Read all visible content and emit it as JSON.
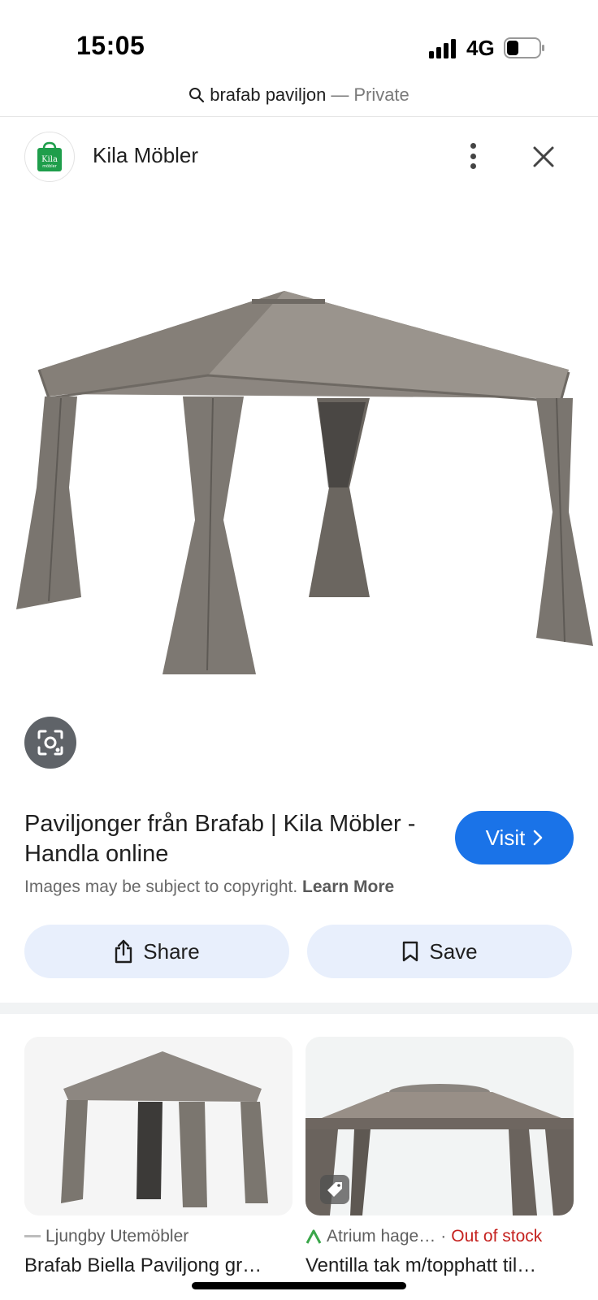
{
  "status_bar": {
    "time": "15:05",
    "network": "4G"
  },
  "search": {
    "query": "brafab paviljon",
    "separator": "—",
    "mode": "Private"
  },
  "source": {
    "name": "Kila Möbler",
    "logo_text": "Kila",
    "logo_sub": "möbler"
  },
  "result": {
    "title": "Paviljonger från Brafab | Kila Möbler - Handla online",
    "visit_label": "Visit",
    "copyright_text": "Images may be subject to copyright.",
    "learn_more": "Learn More"
  },
  "actions": {
    "share_label": "Share",
    "save_label": "Save"
  },
  "related": [
    {
      "source": "Ljungby Utemöbler",
      "title": "Brafab Biella Paviljong gr…",
      "stock": ""
    },
    {
      "source": "Atrium hage…",
      "title": "Ventilla tak m/topphatt til…",
      "stock": "Out of stock",
      "stock_sep": "·"
    }
  ],
  "colors": {
    "accent": "#1a73e8",
    "pill_bg": "#e8effc",
    "out_of_stock": "#c5221f",
    "logo_green": "#1e9e4b"
  },
  "icons": [
    "signal-icon",
    "battery-icon",
    "search-icon",
    "more-vert-icon",
    "close-icon",
    "lens-icon",
    "chevron-right-icon",
    "share-icon",
    "bookmark-icon",
    "tag-icon",
    "atrium-logo-icon"
  ]
}
